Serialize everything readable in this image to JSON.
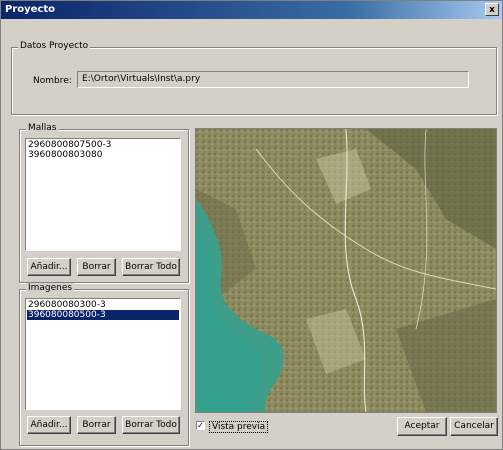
{
  "window": {
    "title": "Proyecto",
    "close_glyph": "x"
  },
  "datos": {
    "legend": "Datos Proyecto",
    "nombre_label": "Nombre:",
    "nombre_value": "E:\\Ortor\\Virtuals\\Inst\\a.pry"
  },
  "mallas": {
    "legend": "Mallas",
    "items": [
      "2960800807500-3",
      "3960800803080"
    ],
    "buttons": {
      "add": "Añadir...",
      "delete": "Borrar",
      "delete_all": "Borrar Todo"
    }
  },
  "imagenes": {
    "legend": "Imagenes",
    "items": [
      "296080080300-3",
      "396080080500-3"
    ],
    "selected_index": 1,
    "buttons": {
      "add": "Añadir...",
      "delete": "Borrar",
      "delete_all": "Borrar Todo"
    }
  },
  "preview": {
    "checkbox_label": "Vista previa",
    "checked": true,
    "check_glyph": "✓"
  },
  "footer": {
    "accept": "Aceptar",
    "cancel": "Cancelar"
  },
  "colors": {
    "titlebar": "#0a246a",
    "selection": "#0a246a",
    "dialog_bg": "#d4d0c8",
    "water": "#3e9e8a",
    "terrain": "#8c8a5c"
  }
}
